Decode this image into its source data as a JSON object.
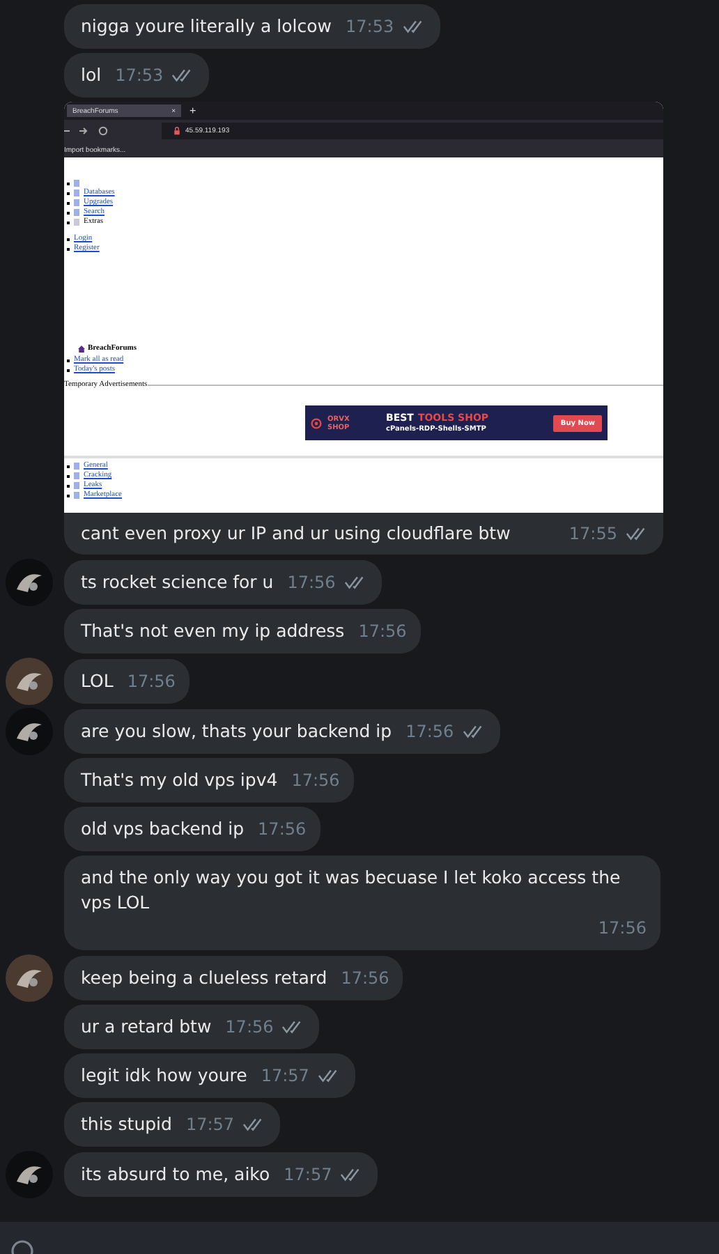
{
  "messages": [
    {
      "text": "nigga youre literally a lolcow",
      "time": "17:53",
      "read": true
    },
    {
      "text": "lol",
      "time": "17:53",
      "read": true
    },
    {
      "text": "cant even proxy ur IP and ur using cloudflare btw",
      "time": "17:55",
      "read": true,
      "screenshot": {
        "tab_title": "BreachForums",
        "tab_close": "×",
        "new_tab": "+",
        "url": "45.59.119.193",
        "bookmark": "Import bookmarks...",
        "nav_items": [
          {
            "linked": true
          },
          {
            "label": "Databases",
            "linked": true
          },
          {
            "label": "Upgrades",
            "linked": true
          },
          {
            "label": "Search",
            "linked": true
          },
          {
            "label": "Extras",
            "linked": false
          }
        ],
        "auth_links": [
          "Login",
          "Register"
        ],
        "forum_title": "BreachForums",
        "quick_links": [
          "Mark all as read",
          "Today's posts"
        ],
        "ad_label": "Temporary Advertisements",
        "ad": {
          "brand": [
            "ORVX",
            "SHOP"
          ],
          "headline": "BEST",
          "headline_accent": "TOOLS SHOP",
          "subline": "cPanels-RDP-Shells-SMTP",
          "button": "Buy Now"
        },
        "categories": [
          "General",
          "Cracking",
          "Leaks",
          "Marketplace"
        ]
      }
    },
    {
      "text": "ts rocket science for u",
      "time": "17:56",
      "read": true
    },
    {
      "text": "That's not even my ip address",
      "time": "17:56",
      "read": false
    },
    {
      "text": "LOL",
      "time": "17:56",
      "read": false
    },
    {
      "text": "are you slow, thats your backend ip",
      "time": "17:56",
      "read": true
    },
    {
      "text": "That's my old vps ipv4",
      "time": "17:56",
      "read": false
    },
    {
      "text": "old vps backend ip",
      "time": "17:56",
      "read": false
    },
    {
      "text": "and the only way you got it was becuase I let koko access the vps LOL",
      "time": "17:56",
      "read": false
    },
    {
      "text": "keep being a clueless retard",
      "time": "17:56",
      "read": false
    },
    {
      "text": "ur a retard btw",
      "time": "17:56",
      "read": true
    },
    {
      "text": "legit idk how youre",
      "time": "17:57",
      "read": true
    },
    {
      "text": "this stupid",
      "time": "17:57",
      "read": true
    },
    {
      "text": "its absurd to me, aiko",
      "time": "17:57",
      "read": true
    }
  ]
}
